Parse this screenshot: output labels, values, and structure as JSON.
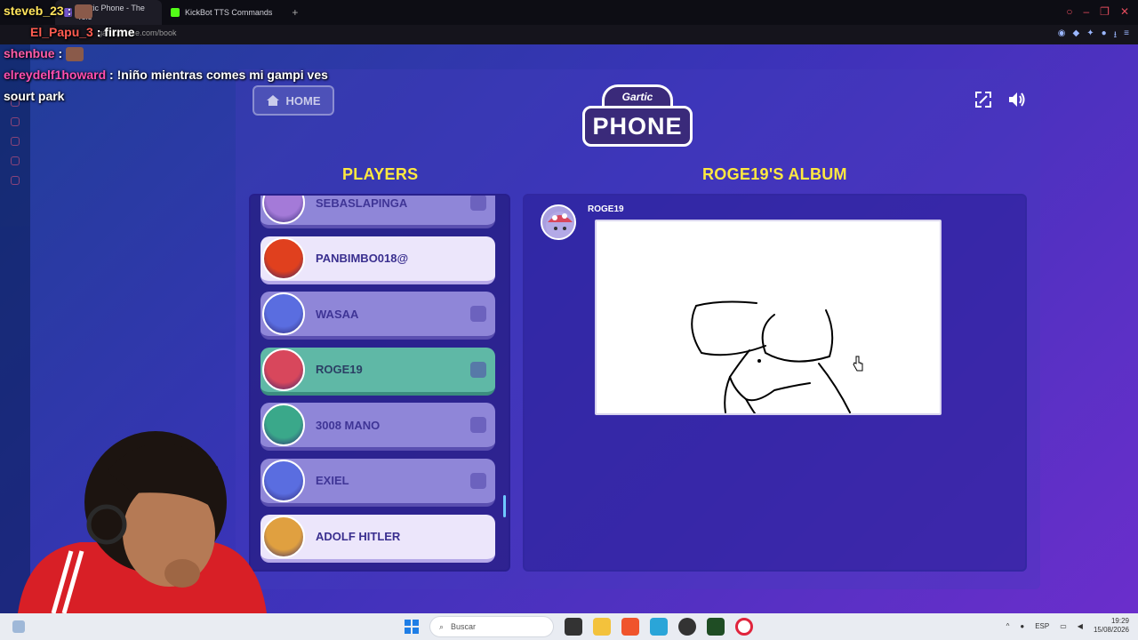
{
  "browser": {
    "tabs": [
      {
        "label": "Gartic Phone - The Tele",
        "active": true
      },
      {
        "label": "KickBot TTS Commands",
        "active": false
      }
    ],
    "new_tab_symbol": "+",
    "address": "garticphone.com/book"
  },
  "chat": [
    {
      "user": "steveb_23",
      "sep": " :",
      "message": ""
    },
    {
      "user": "El_Papu_3",
      "sep": " :",
      "message": " firme"
    },
    {
      "user": "shenbue",
      "sep": " :",
      "message": ""
    },
    {
      "user": "elreydelf1howard",
      "sep": " :",
      "message": " !niño mientras comes mi gampi ves"
    },
    {
      "user": "",
      "sep": "",
      "message": "sourt park"
    }
  ],
  "game": {
    "home_label": "HOME",
    "logo_top": "Gartic",
    "logo_main": "PHONE",
    "players_title": "PLAYERS",
    "album_title": "ROGE19'S ALBUM",
    "players": [
      {
        "name": "SEBASLAPINGA",
        "style": "normal",
        "avatar_color": "#a47ad8"
      },
      {
        "name": "PANBIMBO018@",
        "style": "you",
        "avatar_color": "#e0401e"
      },
      {
        "name": "WASAA",
        "style": "normal",
        "avatar_color": "#5a6de0"
      },
      {
        "name": "ROGE19",
        "style": "highlight",
        "avatar_color": "#d8475c"
      },
      {
        "name": "3008 MANO",
        "style": "normal",
        "avatar_color": "#3aa88a"
      },
      {
        "name": "EXIEL",
        "style": "normal",
        "avatar_color": "#5a6de0"
      },
      {
        "name": "ADOLF HITLER",
        "style": "owner",
        "avatar_color": "#e0a040"
      }
    ],
    "album": {
      "author": "ROGE19"
    }
  },
  "taskbar": {
    "search_placeholder": "Buscar",
    "lang": "ESP",
    "time": "19:29",
    "date": "15/08/2026"
  },
  "colors": {
    "title_yellow": "#ffe940",
    "highlight_teal": "#5fb8a6",
    "player_purple": "#8f86d8"
  }
}
